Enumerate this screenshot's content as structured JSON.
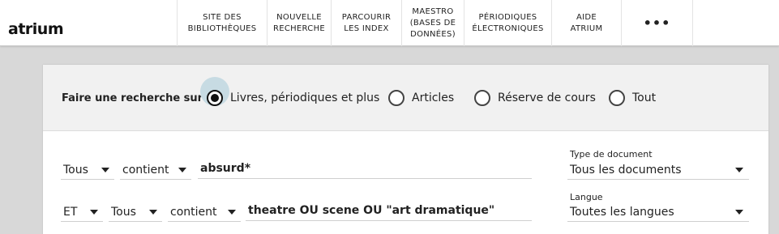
{
  "header": {
    "logo": "atrium",
    "nav": [
      {
        "label": "SITE DES\nBIBLIOTHÈQUES"
      },
      {
        "label": "NOUVELLE\nRECHERCHE"
      },
      {
        "label": "PARCOURIR\nLES INDEX"
      },
      {
        "label": "MAESTRO\n(BASES DE\nDONNÉES)"
      },
      {
        "label": "PÉRIODIQUES\nÉLECTRONIQUES"
      },
      {
        "label": "AIDE\nATRIUM"
      },
      {
        "label": "•••"
      }
    ]
  },
  "scope": {
    "label": "Faire une recherche sur :",
    "options": [
      {
        "label": "Livres, périodiques et plus",
        "selected": true
      },
      {
        "label": "Articles",
        "selected": false
      },
      {
        "label": "Réserve de cours",
        "selected": false
      },
      {
        "label": "Tout",
        "selected": false
      }
    ]
  },
  "rows": [
    {
      "field": "Tous",
      "operator": "contient",
      "query": "absurd*"
    },
    {
      "boolean": "ET",
      "field": "Tous",
      "operator": "contient",
      "query": "theatre OU scene OU \"art dramatique\""
    }
  ],
  "filters": {
    "doc_type": {
      "label": "Type de document",
      "value": "Tous les documents"
    },
    "language": {
      "label": "Langue",
      "value": "Toutes les langues"
    }
  }
}
